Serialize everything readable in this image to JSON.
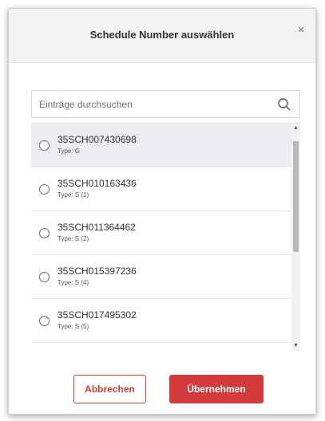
{
  "dialog": {
    "title": "Schedule Number auswählen",
    "close_label": "×"
  },
  "search": {
    "placeholder": "Einträge durchsuchen"
  },
  "items": [
    {
      "number": "35SCH007430698",
      "type": "Type: G",
      "selected": true
    },
    {
      "number": "35SCH010163436",
      "type": "Type: S (1)",
      "selected": false
    },
    {
      "number": "35SCH011364462",
      "type": "Type: S (2)",
      "selected": false
    },
    {
      "number": "35SCH015397236",
      "type": "Type: S (4)",
      "selected": false
    },
    {
      "number": "35SCH017495302",
      "type": "Type: S (5)",
      "selected": false
    }
  ],
  "scrollbar": {
    "up_arrow": "▲",
    "down_arrow": "▼"
  },
  "buttons": {
    "cancel_label": "Abbrechen",
    "apply_label": "Übernehmen"
  },
  "colors": {
    "accent": "#d33c3c",
    "header_bg": "#f3f3f5",
    "selected_row_bg": "#ebedf3"
  }
}
